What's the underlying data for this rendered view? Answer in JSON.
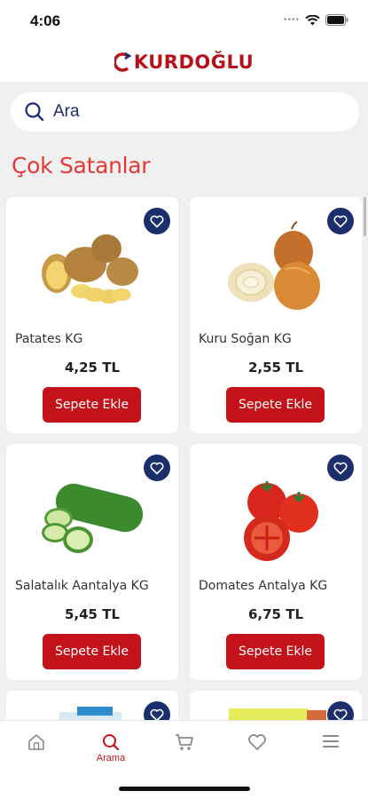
{
  "status_bar": {
    "time": "4:06"
  },
  "header": {
    "logo_text": "KURDOĞLU"
  },
  "search": {
    "placeholder": "Ara"
  },
  "section": {
    "title": "Çok Satanlar"
  },
  "products": [
    {
      "name": "Patates KG",
      "price": "4,25 TL",
      "button": "Sepete Ekle"
    },
    {
      "name": "Kuru Soğan KG",
      "price": "2,55 TL",
      "button": "Sepete Ekle"
    },
    {
      "name": "Salatalık Aantalya KG",
      "price": "5,45 TL",
      "button": "Sepete Ekle"
    },
    {
      "name": "Domates Antalya KG",
      "price": "6,75 TL",
      "button": "Sepete Ekle"
    }
  ],
  "tabs": [
    {
      "icon": "home-icon",
      "label": "",
      "active": false
    },
    {
      "icon": "search-icon",
      "label": "Arama",
      "active": true
    },
    {
      "icon": "cart-icon",
      "label": "",
      "active": false
    },
    {
      "icon": "heart-icon",
      "label": "",
      "active": false
    },
    {
      "icon": "menu-icon",
      "label": "",
      "active": false
    }
  ],
  "colors": {
    "brand_red": "#c4121a",
    "navy": "#1a2f6b",
    "title_red": "#e53935"
  }
}
